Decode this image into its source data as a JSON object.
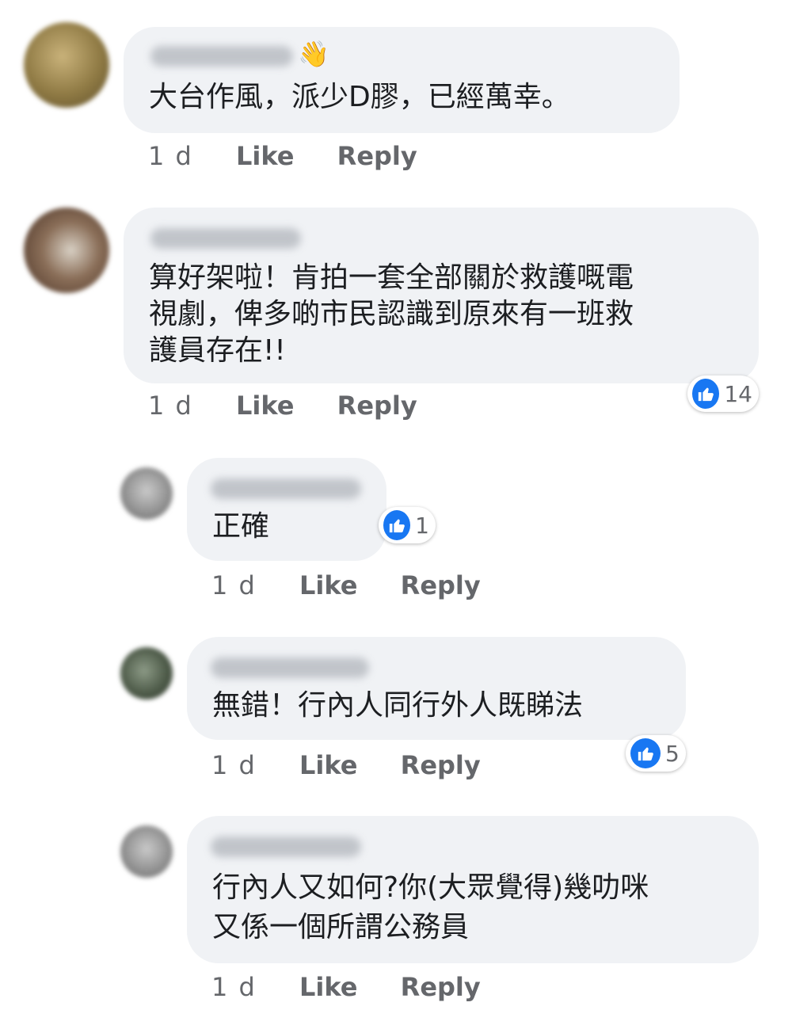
{
  "comments": [
    {
      "text_lines": [
        "大台作風，派少D膠，已經萬幸。"
      ],
      "time": "1 d",
      "like_label": "Like",
      "reply_label": "Reply",
      "author_badge_icon": "waving-hand-icon"
    },
    {
      "text_lines": [
        "算好架啦！肯拍一套全部關於救護嘅電",
        "視劇，俾多啲市民認識到原來有一班救",
        "護員存在!!"
      ],
      "time": "1 d",
      "like_label": "Like",
      "reply_label": "Reply",
      "reaction_count": "14"
    },
    {
      "text_lines": [
        "正確"
      ],
      "time": "1 d",
      "like_label": "Like",
      "reply_label": "Reply",
      "reaction_count": "1"
    },
    {
      "text_lines": [
        "無錯！行內人同行外人既睇法"
      ],
      "time": "1 d",
      "like_label": "Like",
      "reply_label": "Reply",
      "reaction_count": "5"
    },
    {
      "text_lines": [
        "行內人又如何?你(大眾覺得)幾叻咪",
        "又係一個所謂公務員"
      ],
      "time": "1 d",
      "like_label": "Like",
      "reply_label": "Reply"
    }
  ],
  "colors": {
    "bubble": "#f0f2f5",
    "like_blue": "#1877f2",
    "meta_gray": "#65676b"
  }
}
